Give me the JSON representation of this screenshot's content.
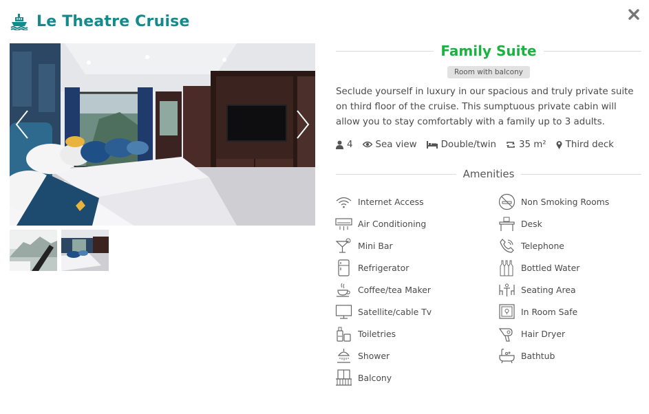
{
  "header": {
    "icon": "cruise-ship-icon",
    "title": "Le Theatre Cruise",
    "close_icon": "close-icon"
  },
  "colors": {
    "brand_teal": "#158a8d",
    "room_name_green": "#1db141",
    "badge_bg": "#e2e2e2",
    "rule": "#dcdcdc"
  },
  "gallery": {
    "prev_icon": "chevron-left-icon",
    "next_icon": "chevron-right-icon",
    "thumbnails": [
      {
        "name": "thumbnail-bay-view"
      },
      {
        "name": "thumbnail-cabin"
      }
    ]
  },
  "room": {
    "name": "Family Suite",
    "badge": "Room with balcony",
    "description": "Seclude yourself in luxury in our spacious and truly private suite on third floor of the cruise. This sumptuous private cabin will allow you to stay comfortably with a family up to 3 adults.",
    "specs": [
      {
        "icon": "guests-icon",
        "label": "4"
      },
      {
        "icon": "eye-icon",
        "label": "Sea view"
      },
      {
        "icon": "bed-icon",
        "label": "Double/twin"
      },
      {
        "icon": "area-icon",
        "label": "35 m²"
      },
      {
        "icon": "location-pin-icon",
        "label": "Third deck"
      }
    ]
  },
  "amenities": {
    "title": "Amenities",
    "items": [
      {
        "icon": "wifi-icon",
        "label": "Internet Access"
      },
      {
        "icon": "no-smoking-icon",
        "label": "Non Smoking Rooms"
      },
      {
        "icon": "air-conditioning-icon",
        "label": "Air Conditioning"
      },
      {
        "icon": "desk-icon",
        "label": "Desk"
      },
      {
        "icon": "cocktail-icon",
        "label": "Mini Bar"
      },
      {
        "icon": "telephone-icon",
        "label": "Telephone"
      },
      {
        "icon": "refrigerator-icon",
        "label": "Refrigerator"
      },
      {
        "icon": "bottles-icon",
        "label": "Bottled Water"
      },
      {
        "icon": "coffee-cup-icon",
        "label": "Coffee/tea Maker"
      },
      {
        "icon": "seating-icon",
        "label": "Seating Area"
      },
      {
        "icon": "tv-icon",
        "label": "Satellite/cable Tv"
      },
      {
        "icon": "safe-icon",
        "label": "In Room Safe"
      },
      {
        "icon": "toiletries-icon",
        "label": "Toiletries"
      },
      {
        "icon": "hair-dryer-icon",
        "label": "Hair Dryer"
      },
      {
        "icon": "shower-icon",
        "label": "Shower"
      },
      {
        "icon": "bathtub-icon",
        "label": "Bathtub"
      },
      {
        "icon": "balcony-icon",
        "label": "Balcony"
      }
    ]
  }
}
